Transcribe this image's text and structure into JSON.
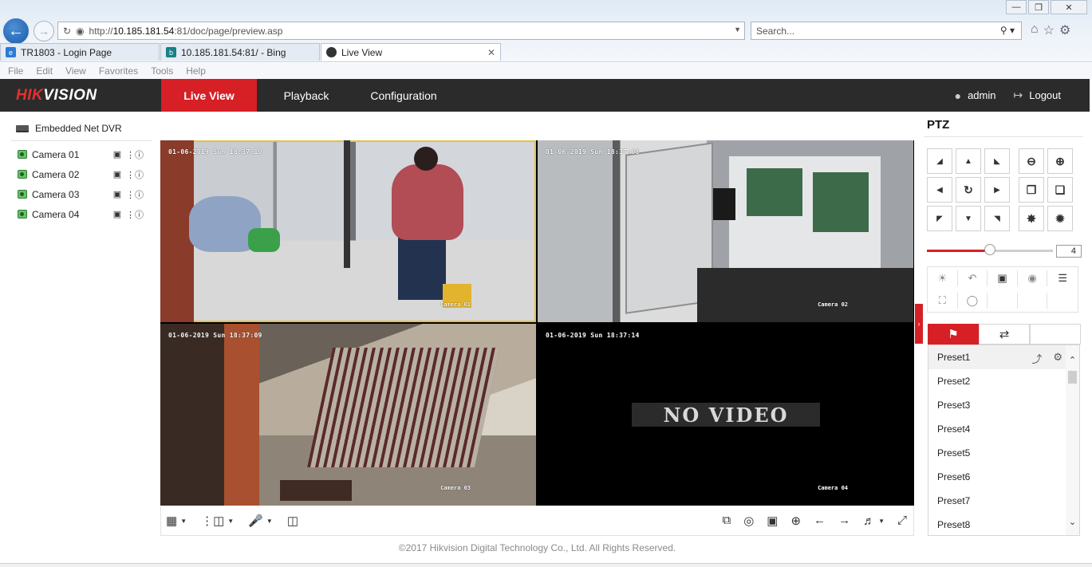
{
  "browser": {
    "url_prefix": "http://",
    "url_host": "10.185.181.54",
    "url_path": ":81/doc/page/preview.asp",
    "search_placeholder": "Search...",
    "tabs": [
      {
        "label": "TR1803 - Login Page",
        "icon": "ie-icon",
        "color": "#2a7bd6"
      },
      {
        "label": "10.185.181.54:81/ - Bing",
        "icon": "bing-icon",
        "color": "#1a7f86"
      },
      {
        "label": "Live View",
        "icon": "hikvision-icon",
        "color": "#333333"
      }
    ],
    "menu": [
      "File",
      "Edit",
      "View",
      "Favorites",
      "Tools",
      "Help"
    ]
  },
  "header": {
    "logo_red": "HIK",
    "logo_white": "VISION",
    "nav": [
      "Live View",
      "Playback",
      "Configuration"
    ],
    "user": "admin",
    "logout": "Logout",
    "accent": "#d71f26"
  },
  "tree": {
    "root": "Embedded Net DVR",
    "cameras": [
      "Camera 01",
      "Camera 02",
      "Camera 03",
      "Camera 04"
    ]
  },
  "video": {
    "cells": [
      {
        "time": "01-06-2019 Sun 18:37:10",
        "name": "Camera 01"
      },
      {
        "time": "01-06-2019 Sun 18:37:08",
        "name": "Camera 02"
      },
      {
        "time": "01-06-2019 Sun 18:37:09",
        "name": "Camera 03"
      },
      {
        "time": "01-06-2019 Sun 18:37:14",
        "name": "Camera 04"
      }
    ],
    "no_video": "NO VIDEO"
  },
  "footer": "©2017 Hikvision Digital Technology Co., Ltd. All Rights Reserved.",
  "ptz": {
    "title": "PTZ",
    "speed": "4",
    "speed_fraction": 0.5,
    "presets": [
      "Preset1",
      "Preset2",
      "Preset3",
      "Preset4",
      "Preset5",
      "Preset6",
      "Preset7",
      "Preset8"
    ]
  }
}
